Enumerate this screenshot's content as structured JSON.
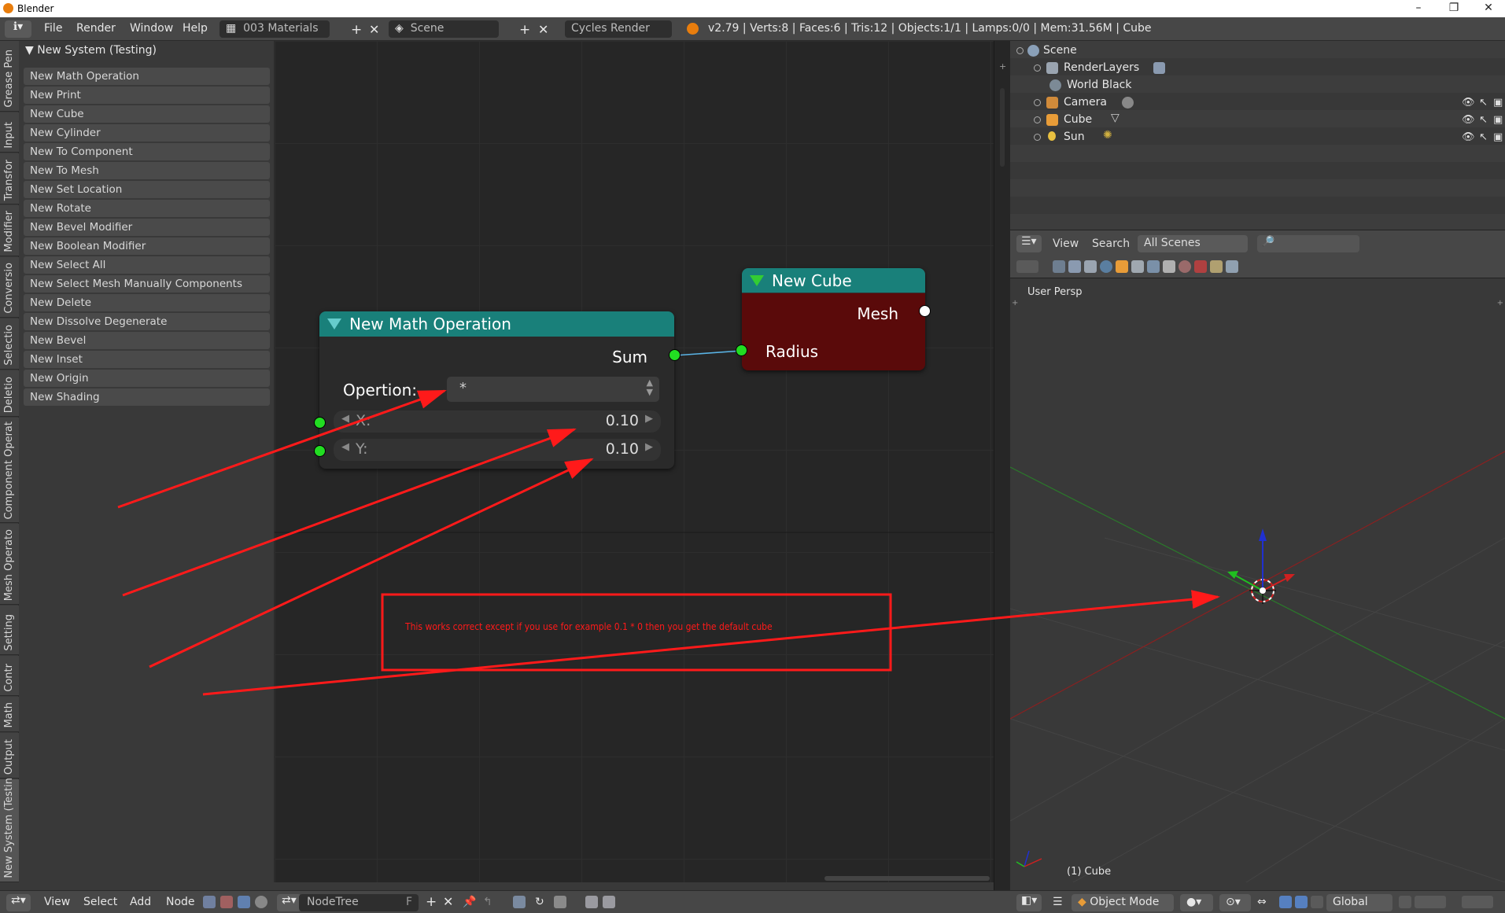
{
  "window": {
    "title": "Blender",
    "controls": [
      "–",
      "❐",
      "✕"
    ]
  },
  "info_header": {
    "menus": [
      "File",
      "Render",
      "Window",
      "Help"
    ],
    "screen_layout": "003 Materials",
    "scene": "Scene",
    "engine": "Cycles Render",
    "stats": "v2.79 | Verts:8 | Faces:6 | Tris:12 | Objects:1/1 | Lamps:0/0 | Mem:31.56M | Cube"
  },
  "tool_tabs": [
    "Grease Pen",
    "Input",
    "Transfor",
    "Modifier",
    "Conversio",
    "Selectio",
    "Deletio",
    "Component Operat",
    "Mesh Operato",
    "Setting",
    "Contr",
    "Math",
    "Output",
    "New System (Testin"
  ],
  "tool_panel": {
    "header": "New System (Testing)",
    "buttons": [
      "New Math Operation",
      "New Print",
      "New Cube",
      "New Cylinder",
      "New To Component",
      "New To Mesh",
      "New Set Location",
      "New Rotate",
      "New Bevel Modifier",
      "New Boolean Modifier",
      "New Select All",
      "New Select Mesh Manually Components",
      "New Delete",
      "New Dissolve Degenerate",
      "New Bevel",
      "New Inset",
      "New Origin",
      "New Shading"
    ]
  },
  "math_node": {
    "title": "New Math Operation",
    "output_label": "Sum",
    "operation_label": "Opertion:",
    "operation_value": "*",
    "x_label": "X:",
    "x_value": "0.10",
    "y_label": "Y:",
    "y_value": "0.10"
  },
  "cube_node": {
    "title": "New Cube",
    "output_label": "Mesh",
    "input_label": "Radius"
  },
  "annotation": {
    "note": "This works correct except if you use for example 0.1 * 0 then you get the default cube",
    "color": "#ff1a1a"
  },
  "outliner": {
    "items": [
      "Scene",
      "RenderLayers",
      "World Black",
      "Camera",
      "Cube",
      "Sun"
    ],
    "header_view": "View",
    "header_search": "Search",
    "filter": "All Scenes"
  },
  "viewport": {
    "perspective": "User Persp",
    "object_label": "(1) Cube",
    "mode": "Object Mode",
    "orientation": "Global"
  },
  "node_header": {
    "menus": [
      "View",
      "Select",
      "Add",
      "Node"
    ],
    "tree_name": "NodeTree",
    "fake_user": "F"
  },
  "colors": {
    "node_header": "#19807a",
    "cube_body": "#5a0a0a",
    "socket": "#22dd22",
    "annotation": "#ff1a1a"
  }
}
